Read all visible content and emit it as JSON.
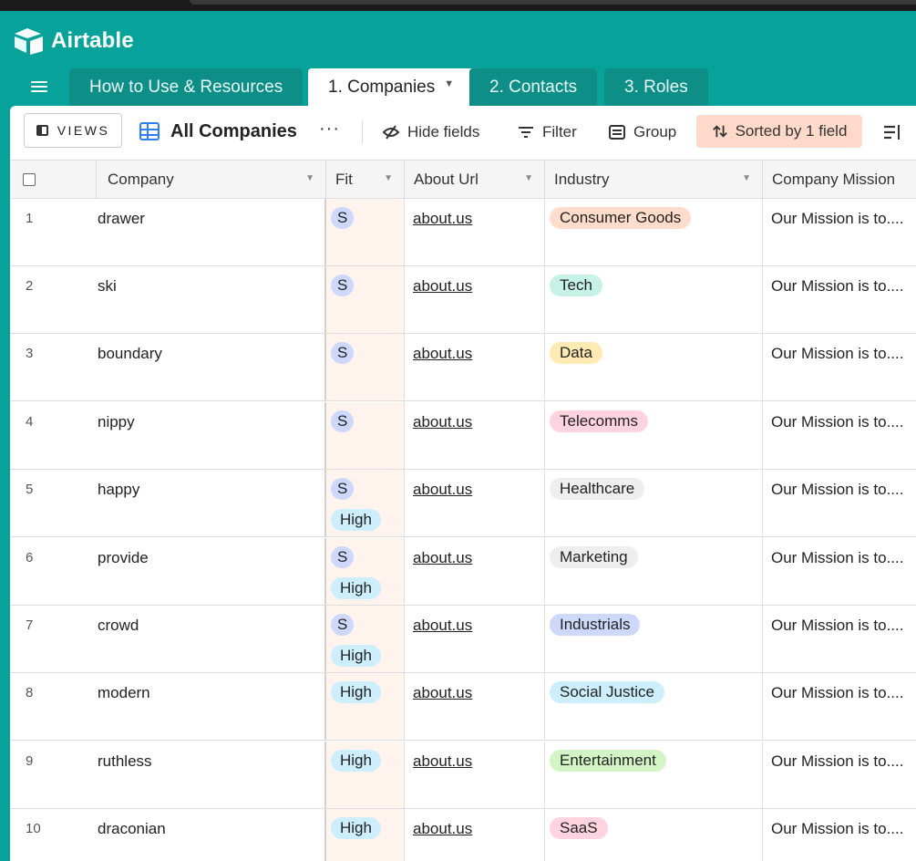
{
  "app": {
    "name": "Airtable"
  },
  "tabs": [
    {
      "label": "How to Use & Resources"
    },
    {
      "label": "1. Companies"
    },
    {
      "label": "2. Contacts"
    },
    {
      "label": "3. Roles"
    }
  ],
  "toolbar": {
    "views_label": "VIEWS",
    "view_name": "All Companies",
    "more": "···",
    "hide_fields": "Hide fields",
    "filter": "Filter",
    "group": "Group",
    "sorted": "Sorted by 1 field"
  },
  "columns": {
    "company": "Company",
    "fit": "Fit",
    "about_url": "About Url",
    "industry": "Industry",
    "mission": "Company Mission"
  },
  "colors": {
    "S": "#cdd8fb",
    "High": "#cdeefc",
    "Consumer Goods": "#ffdccc",
    "Tech": "#c6f2e6",
    "Data": "#ffeab3",
    "Telecomms": "#ffd3df",
    "Healthcare": "#eeeeee",
    "Marketing": "#eeeeee",
    "Industrials": "#cdd8fb",
    "Social Justice": "#cdeefc",
    "Entertainment": "#d3f5c6",
    "SaaS": "#ffd3df"
  },
  "rows": [
    {
      "num": "1",
      "company": "drawer",
      "fit": [
        "S"
      ],
      "url": "about.us",
      "industry": "Consumer Goods",
      "mission": "Our Mission is to...."
    },
    {
      "num": "2",
      "company": "ski",
      "fit": [
        "S"
      ],
      "url": "about.us",
      "industry": "Tech",
      "mission": "Our Mission is to...."
    },
    {
      "num": "3",
      "company": "boundary",
      "fit": [
        "S"
      ],
      "url": "about.us",
      "industry": "Data",
      "mission": "Our Mission is to...."
    },
    {
      "num": "4",
      "company": "nippy",
      "fit": [
        "S"
      ],
      "url": "about.us",
      "industry": "Telecomms",
      "mission": "Our Mission is to...."
    },
    {
      "num": "5",
      "company": "happy",
      "fit": [
        "S",
        "High"
      ],
      "url": "about.us",
      "industry": "Healthcare",
      "mission": "Our Mission is to...."
    },
    {
      "num": "6",
      "company": "provide",
      "fit": [
        "S",
        "High"
      ],
      "url": "about.us",
      "industry": "Marketing",
      "mission": "Our Mission is to...."
    },
    {
      "num": "7",
      "company": "crowd",
      "fit": [
        "S",
        "High"
      ],
      "url": "about.us",
      "industry": "Industrials",
      "mission": "Our Mission is to...."
    },
    {
      "num": "8",
      "company": "modern",
      "fit": [
        "High"
      ],
      "url": "about.us",
      "industry": "Social Justice",
      "mission": "Our Mission is to...."
    },
    {
      "num": "9",
      "company": "ruthless",
      "fit": [
        "High"
      ],
      "url": "about.us",
      "industry": "Entertainment",
      "mission": "Our Mission is to...."
    },
    {
      "num": "10",
      "company": "draconian",
      "fit": [
        "High"
      ],
      "url": "about.us",
      "industry": "SaaS",
      "mission": "Our Mission is to...."
    }
  ]
}
